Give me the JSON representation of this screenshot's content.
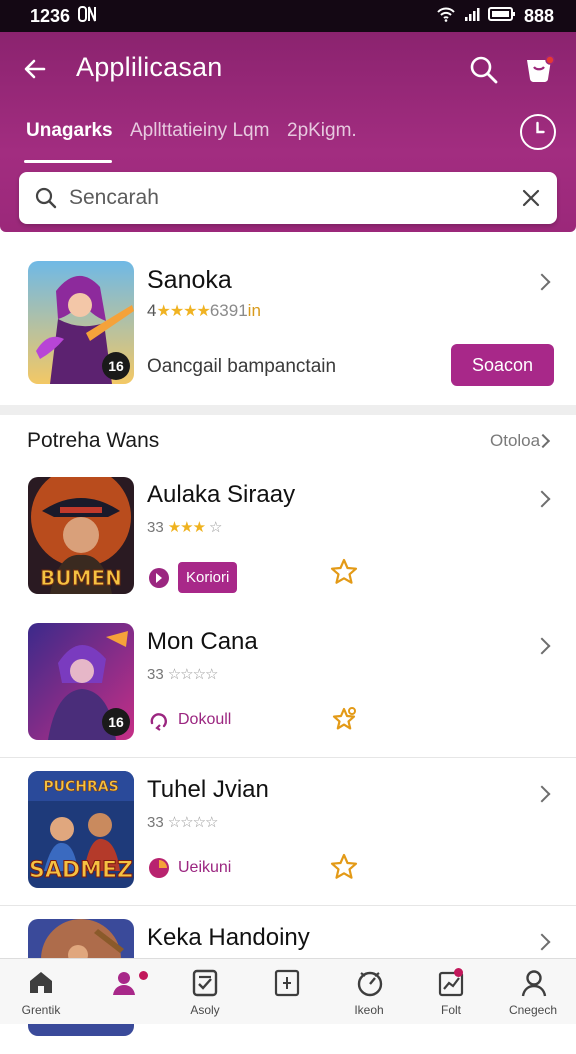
{
  "status_bar": {
    "time": "1236",
    "battery": "888"
  },
  "header": {
    "title": "Applilicasan",
    "tabs": [
      {
        "label": "Unagarks",
        "active": true
      },
      {
        "label": "Apllttatieiny Lqm",
        "active": false
      },
      {
        "label": "2pKigm.",
        "active": false
      }
    ],
    "search": {
      "placeholder": "Sencarah"
    }
  },
  "featured": {
    "title": "Sanoka",
    "rating_prefix": "4",
    "stars": "★★★★",
    "rating_count": "6391",
    "rating_suffix": "in",
    "subtitle": "Oancgail bampanctain",
    "button_label": "Soacon",
    "badge": "16"
  },
  "section": {
    "title": "Potreha Wans",
    "more": "Otoloa"
  },
  "items": [
    {
      "title": "Aulaka Siraay",
      "rating_value": "33",
      "stars_on": "★★★",
      "stars_off": "☆",
      "action_label": "Koriori",
      "action_type": "pill",
      "thumb_text": "BUMEN",
      "badge": ""
    },
    {
      "title": "Mon Cana",
      "rating_value": "33",
      "stars_on": "",
      "stars_off": "☆☆☆☆",
      "action_label": "Dokoull",
      "action_type": "text",
      "thumb_text": "",
      "badge": "16"
    },
    {
      "title": "Tuhel Jvian",
      "rating_value": "33",
      "stars_on": "",
      "stars_off": "☆☆☆☆",
      "action_label": "Ueikuni",
      "action_type": "text",
      "thumb_text": "SADMEZ",
      "thumb_top_text": "PUCHRAS",
      "badge": ""
    },
    {
      "title": "Keka Handoiny",
      "rating_value": "",
      "stars_on": "",
      "stars_off": "",
      "action_label": "",
      "action_type": "none",
      "thumb_text": "",
      "badge": ""
    }
  ],
  "bottom_nav": [
    {
      "label": "Grentik",
      "icon": "home-icon"
    },
    {
      "label": "",
      "icon": "people-icon",
      "active": true
    },
    {
      "label": "Asoly",
      "icon": "checklist-icon"
    },
    {
      "label": "",
      "icon": "plus-box-icon"
    },
    {
      "label": "Ikeoh",
      "icon": "gauge-icon"
    },
    {
      "label": "Folt",
      "icon": "chart-icon"
    },
    {
      "label": "Cnegech",
      "icon": "profile-icon"
    }
  ],
  "colors": {
    "primary": "#a82889",
    "header": "#9b287a",
    "star": "#efb21f"
  }
}
